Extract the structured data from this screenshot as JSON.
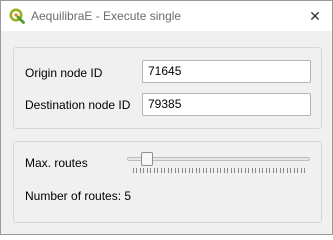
{
  "window": {
    "title": "AequilibraE - Execute single",
    "close_glyph": "✕",
    "icon": "qgis-logo-icon"
  },
  "nodes": {
    "origin_label": "Origin node ID",
    "origin_value": "71645",
    "destination_label": "Destination node ID",
    "destination_value": "79385"
  },
  "routes": {
    "label": "Max. routes",
    "slider_min": 1,
    "slider_max": 50,
    "slider_value": 5,
    "tick_count": 50,
    "count_text": "Number of routes: 5"
  },
  "colors": {
    "qgis_green": "#93b023",
    "qgis_yellow": "#ee7913"
  }
}
